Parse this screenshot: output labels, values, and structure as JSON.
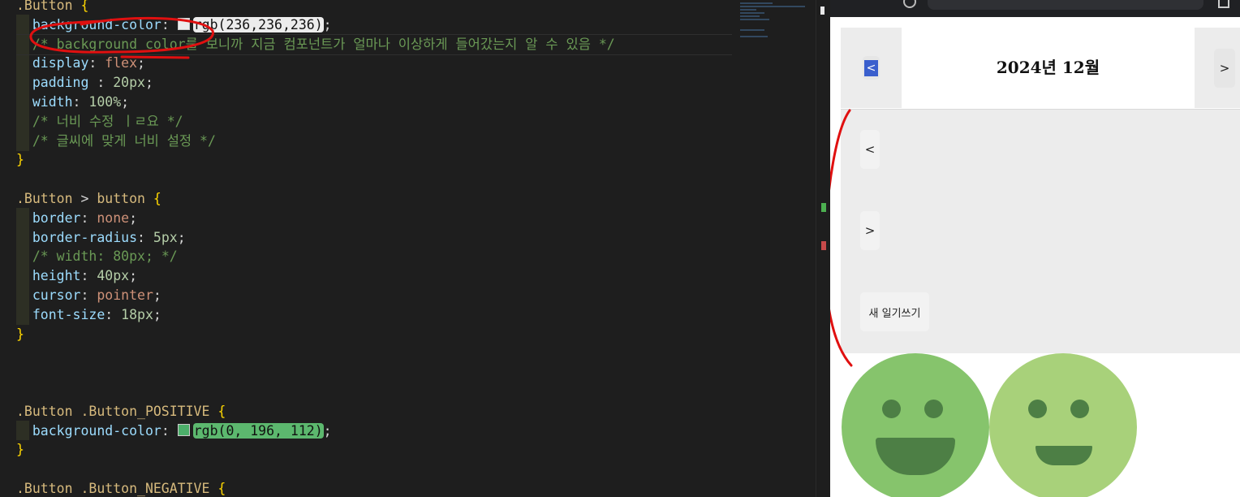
{
  "editor": {
    "lines": [
      {
        "segs": [
          {
            "t": ".Button ",
            "c": "sel"
          },
          {
            "t": "{",
            "c": "brace"
          }
        ]
      },
      {
        "segs": [
          {
            "t": "  "
          },
          {
            "t": "background-color",
            "c": "prop"
          },
          {
            "t": ": ",
            "c": "punct"
          },
          {
            "swatch": "#ececec"
          },
          {
            "t": "rgb(236,236,236)",
            "c": "hl",
            "bg": "#ececec",
            "fg": "#111111"
          },
          {
            "t": ";",
            "c": "punct"
          }
        ]
      },
      {
        "segs": [
          {
            "t": "  "
          },
          {
            "t": "/* background color를 보니까 지금 컴포넌트가 얼마나 이상하게 들어갔는지 알 수 있음 */",
            "c": "cmt"
          }
        ]
      },
      {
        "segs": [
          {
            "t": "  "
          },
          {
            "t": "display",
            "c": "prop"
          },
          {
            "t": ": ",
            "c": "punct"
          },
          {
            "t": "flex",
            "c": "val"
          },
          {
            "t": ";",
            "c": "punct"
          }
        ]
      },
      {
        "segs": [
          {
            "t": "  "
          },
          {
            "t": "padding ",
            "c": "prop"
          },
          {
            "t": ": ",
            "c": "punct"
          },
          {
            "t": "20px",
            "c": "num"
          },
          {
            "t": ";",
            "c": "punct"
          }
        ]
      },
      {
        "segs": [
          {
            "t": "  "
          },
          {
            "t": "width",
            "c": "prop"
          },
          {
            "t": ": ",
            "c": "punct"
          },
          {
            "t": "100%",
            "c": "num"
          },
          {
            "t": ";",
            "c": "punct"
          }
        ]
      },
      {
        "segs": [
          {
            "t": "  "
          },
          {
            "t": "/* 너비 수정 ㅣㄹ요 */",
            "c": "cmt"
          }
        ]
      },
      {
        "segs": [
          {
            "t": "  "
          },
          {
            "t": "/* 글씨에 맞게 너비 설정 */",
            "c": "cmt"
          }
        ]
      },
      {
        "segs": [
          {
            "t": "}",
            "c": "brace"
          }
        ]
      },
      {
        "segs": []
      },
      {
        "segs": [
          {
            "t": ".Button ",
            "c": "sel"
          },
          {
            "t": "> ",
            "c": "punct"
          },
          {
            "t": "button ",
            "c": "sel"
          },
          {
            "t": "{",
            "c": "brace"
          }
        ]
      },
      {
        "segs": [
          {
            "t": "  "
          },
          {
            "t": "border",
            "c": "prop"
          },
          {
            "t": ": ",
            "c": "punct"
          },
          {
            "t": "none",
            "c": "val"
          },
          {
            "t": ";",
            "c": "punct"
          }
        ]
      },
      {
        "segs": [
          {
            "t": "  "
          },
          {
            "t": "border-radius",
            "c": "prop"
          },
          {
            "t": ": ",
            "c": "punct"
          },
          {
            "t": "5px",
            "c": "num"
          },
          {
            "t": ";",
            "c": "punct"
          }
        ]
      },
      {
        "segs": [
          {
            "t": "  "
          },
          {
            "t": "/* width: 80px; */",
            "c": "cmt"
          }
        ]
      },
      {
        "segs": [
          {
            "t": "  "
          },
          {
            "t": "height",
            "c": "prop"
          },
          {
            "t": ": ",
            "c": "punct"
          },
          {
            "t": "40px",
            "c": "num"
          },
          {
            "t": ";",
            "c": "punct"
          }
        ]
      },
      {
        "segs": [
          {
            "t": "  "
          },
          {
            "t": "cursor",
            "c": "prop"
          },
          {
            "t": ": ",
            "c": "punct"
          },
          {
            "t": "pointer",
            "c": "val"
          },
          {
            "t": ";",
            "c": "punct"
          }
        ]
      },
      {
        "segs": [
          {
            "t": "  "
          },
          {
            "t": "font-size",
            "c": "prop"
          },
          {
            "t": ": ",
            "c": "punct"
          },
          {
            "t": "18px",
            "c": "num"
          },
          {
            "t": ";",
            "c": "punct"
          }
        ]
      },
      {
        "segs": [
          {
            "t": "}",
            "c": "brace"
          }
        ]
      },
      {
        "segs": []
      },
      {
        "segs": []
      },
      {
        "segs": []
      },
      {
        "segs": [
          {
            "t": ".Button .Button_POSITIVE ",
            "c": "sel"
          },
          {
            "t": "{",
            "c": "brace"
          }
        ]
      },
      {
        "segs": [
          {
            "t": "  "
          },
          {
            "t": "background-color",
            "c": "prop"
          },
          {
            "t": ": ",
            "c": "punct"
          },
          {
            "swatch": "#4caf6a"
          },
          {
            "t": "rgb(0, 196, 112)",
            "c": "hl",
            "bg": "#5cb86e",
            "fg": "#111111"
          },
          {
            "t": ";",
            "c": "punct"
          }
        ]
      },
      {
        "segs": [
          {
            "t": "}",
            "c": "brace"
          }
        ]
      },
      {
        "segs": []
      },
      {
        "segs": [
          {
            "t": ".Button .Button_NEGATIVE ",
            "c": "sel"
          },
          {
            "t": "{",
            "c": "brace"
          }
        ]
      }
    ]
  },
  "calendar": {
    "title": "2024년 12월",
    "prev": "<",
    "next": ">"
  },
  "buttons": {
    "prev": "<",
    "next": ">",
    "new_diary": "새 일기쓰기"
  },
  "colors": {
    "annotation_red": "#e01010",
    "face_dark_green": "#86c46c",
    "face_light_green": "#a8d17a",
    "face_feature": "#4d7f45",
    "gutter_added": "#4caf50",
    "gutter_removed": "#c74a4a"
  }
}
